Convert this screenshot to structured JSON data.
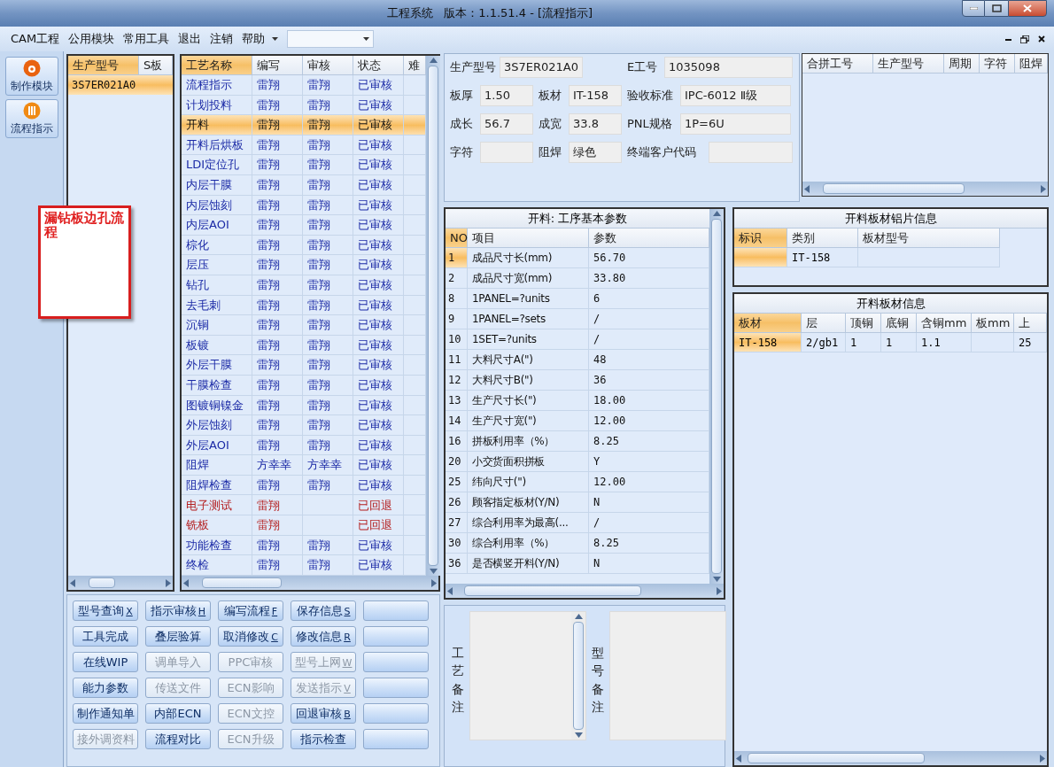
{
  "window": {
    "title": "工程系统   版本：1.1.51.4 - [流程指示]"
  },
  "menu": [
    "CAM工程",
    "公用模块",
    "常用工具",
    "退出",
    "注销",
    "帮助"
  ],
  "nav": [
    {
      "label": "制作模块",
      "kind": "flame"
    },
    {
      "label": "流程指示",
      "kind": "bars"
    }
  ],
  "note": {
    "text": "漏钻板边孔流程"
  },
  "products": {
    "columns": [
      "生产型号",
      "S板"
    ],
    "rows": [
      {
        "model": "3S7ER021A0",
        "selected": true
      }
    ]
  },
  "process": {
    "columns": [
      "工艺名称",
      "编写",
      "审核",
      "状态",
      "难"
    ],
    "rows": [
      {
        "name": "流程指示",
        "writer": "雷翔",
        "reviewer": "雷翔",
        "status": "已审核",
        "returned": false,
        "selected": false
      },
      {
        "name": "计划投料",
        "writer": "雷翔",
        "reviewer": "雷翔",
        "status": "已审核",
        "returned": false,
        "selected": false
      },
      {
        "name": "开料",
        "writer": "雷翔",
        "reviewer": "雷翔",
        "status": "已审核",
        "returned": false,
        "selected": true
      },
      {
        "name": "开料后烘板",
        "writer": "雷翔",
        "reviewer": "雷翔",
        "status": "已审核",
        "returned": false,
        "selected": false
      },
      {
        "name": "LDI定位孔",
        "writer": "雷翔",
        "reviewer": "雷翔",
        "status": "已审核",
        "returned": false,
        "selected": false
      },
      {
        "name": "内层干膜",
        "writer": "雷翔",
        "reviewer": "雷翔",
        "status": "已审核",
        "returned": false,
        "selected": false
      },
      {
        "name": "内层蚀刻",
        "writer": "雷翔",
        "reviewer": "雷翔",
        "status": "已审核",
        "returned": false,
        "selected": false
      },
      {
        "name": "内层AOI",
        "writer": "雷翔",
        "reviewer": "雷翔",
        "status": "已审核",
        "returned": false,
        "selected": false
      },
      {
        "name": "棕化",
        "writer": "雷翔",
        "reviewer": "雷翔",
        "status": "已审核",
        "returned": false,
        "selected": false
      },
      {
        "name": "层压",
        "writer": "雷翔",
        "reviewer": "雷翔",
        "status": "已审核",
        "returned": false,
        "selected": false
      },
      {
        "name": "钻孔",
        "writer": "雷翔",
        "reviewer": "雷翔",
        "status": "已审核",
        "returned": false,
        "selected": false
      },
      {
        "name": "去毛刺",
        "writer": "雷翔",
        "reviewer": "雷翔",
        "status": "已审核",
        "returned": false,
        "selected": false
      },
      {
        "name": "沉铜",
        "writer": "雷翔",
        "reviewer": "雷翔",
        "status": "已审核",
        "returned": false,
        "selected": false
      },
      {
        "name": "板镀",
        "writer": "雷翔",
        "reviewer": "雷翔",
        "status": "已审核",
        "returned": false,
        "selected": false
      },
      {
        "name": "外层干膜",
        "writer": "雷翔",
        "reviewer": "雷翔",
        "status": "已审核",
        "returned": false,
        "selected": false
      },
      {
        "name": "干膜检查",
        "writer": "雷翔",
        "reviewer": "雷翔",
        "status": "已审核",
        "returned": false,
        "selected": false
      },
      {
        "name": "图镀铜镍金",
        "writer": "雷翔",
        "reviewer": "雷翔",
        "status": "已审核",
        "returned": false,
        "selected": false
      },
      {
        "name": "外层蚀刻",
        "writer": "雷翔",
        "reviewer": "雷翔",
        "status": "已审核",
        "returned": false,
        "selected": false
      },
      {
        "name": "外层AOI",
        "writer": "雷翔",
        "reviewer": "雷翔",
        "status": "已审核",
        "returned": false,
        "selected": false
      },
      {
        "name": "阻焊",
        "writer": "方幸幸",
        "reviewer": "方幸幸",
        "status": "已审核",
        "returned": false,
        "selected": false
      },
      {
        "name": "阻焊检查",
        "writer": "雷翔",
        "reviewer": "雷翔",
        "status": "已审核",
        "returned": false,
        "selected": false
      },
      {
        "name": "电子测试",
        "writer": "雷翔",
        "status": "已回退",
        "returned": true,
        "selected": false
      },
      {
        "name": "铣板",
        "writer": "雷翔",
        "status": "已回退",
        "returned": true,
        "selected": false
      },
      {
        "name": "功能检查",
        "writer": "雷翔",
        "reviewer": "雷翔",
        "status": "已审核",
        "returned": false,
        "selected": false
      },
      {
        "name": "终检",
        "writer": "雷翔",
        "reviewer": "雷翔",
        "status": "已审核",
        "returned": false,
        "selected": false
      }
    ]
  },
  "actions": [
    {
      "label": "型号查询",
      "shortcut": "X",
      "disabled": false
    },
    {
      "label": "指示审核",
      "shortcut": "H",
      "disabled": false
    },
    {
      "label": "编写流程",
      "shortcut": "F",
      "disabled": false
    },
    {
      "label": "保存信息",
      "shortcut": "S",
      "disabled": false
    },
    {
      "disabled": false
    },
    {
      "label": "工具完成",
      "disabled": false
    },
    {
      "label": "叠层验算",
      "disabled": false
    },
    {
      "label": "取消修改",
      "shortcut": "C",
      "disabled": false
    },
    {
      "label": "修改信息",
      "shortcut": "R",
      "disabled": false
    },
    {
      "disabled": false
    },
    {
      "label": "在线WIP",
      "disabled": false
    },
    {
      "label": "调单导入",
      "disabled": true
    },
    {
      "label": "PPC审核",
      "disabled": true
    },
    {
      "label": "型号上网",
      "shortcut": "W",
      "disabled": true
    },
    {
      "disabled": false
    },
    {
      "label": "能力参数",
      "disabled": false
    },
    {
      "label": "传送文件",
      "disabled": true
    },
    {
      "label": "ECN影响",
      "disabled": true
    },
    {
      "label": "发送指示",
      "shortcut": "V",
      "disabled": true
    },
    {
      "disabled": false
    },
    {
      "label": "制作通知单",
      "disabled": false
    },
    {
      "label": "内部ECN",
      "disabled": false
    },
    {
      "label": "ECN文控",
      "disabled": true
    },
    {
      "label": "回退审核",
      "shortcut": "B",
      "disabled": false
    },
    {
      "disabled": false
    },
    {
      "label": "接外调资料",
      "disabled": true
    },
    {
      "label": "流程对比",
      "disabled": false
    },
    {
      "label": "ECN升级",
      "disabled": true
    },
    {
      "label": "指示检查",
      "disabled": false
    },
    {
      "disabled": false
    }
  ],
  "info": {
    "rows": [
      [
        {
          "label": "生产型号",
          "value": "3S7ER021A0"
        },
        null,
        {
          "label": "E工号",
          "value": "1035098"
        }
      ],
      [
        {
          "label": "板厚",
          "value": "1.50"
        },
        {
          "label": "板材",
          "value": "IT-158"
        },
        {
          "label": "验收标准",
          "value": "IPC-6012 Ⅱ级"
        }
      ],
      [
        {
          "label": "成长",
          "value": "56.7"
        },
        {
          "label": "成宽",
          "value": "33.8"
        },
        {
          "label": "PNL规格",
          "value": "1P=6U"
        }
      ],
      [
        {
          "label": "字符"
        },
        {
          "label": "阻焊",
          "value": "绿色"
        },
        {
          "label": "终端客户代码"
        }
      ]
    ]
  },
  "merge_grid": {
    "columns": [
      "合拼工号",
      "生产型号",
      "周期",
      "字符",
      "阻焊"
    ]
  },
  "params": {
    "title": "开料: 工序基本参数",
    "columns": [
      "NO",
      "项目",
      "参数"
    ],
    "rows": [
      {
        "no": "1",
        "item": "成品尺寸长(mm)",
        "value": "56.70",
        "selected": true
      },
      {
        "no": "2",
        "item": "成品尺寸宽(mm)",
        "value": "33.80",
        "selected": false
      },
      {
        "no": "8",
        "item": "1PANEL=?units",
        "value": "6",
        "selected": false
      },
      {
        "no": "9",
        "item": "1PANEL=?sets",
        "value": "/",
        "selected": false
      },
      {
        "no": "10",
        "item": "1SET=?units",
        "value": "/",
        "selected": false
      },
      {
        "no": "11",
        "item": "大料尺寸A(\")",
        "value": "48",
        "selected": false
      },
      {
        "no": "12",
        "item": "大料尺寸B(\")",
        "value": "36",
        "selected": false
      },
      {
        "no": "13",
        "item": "生产尺寸长(\")",
        "value": "18.00",
        "selected": false
      },
      {
        "no": "14",
        "item": "生产尺寸宽(\")",
        "value": "12.00",
        "selected": false
      },
      {
        "no": "16",
        "item": "拼板利用率（%）",
        "value": "8.25",
        "selected": false
      },
      {
        "no": "20",
        "item": "小交货面积拼板",
        "value": "Y",
        "selected": false
      },
      {
        "no": "25",
        "item": "纬向尺寸(\")",
        "value": "12.00",
        "selected": false
      },
      {
        "no": "26",
        "item": "顾客指定板材(Y/N)",
        "value": "N",
        "selected": false
      },
      {
        "no": "27",
        "item": "综合利用率为最高(...",
        "value": "/",
        "selected": false
      },
      {
        "no": "30",
        "item": "综合利用率（%）",
        "value": "8.25",
        "selected": false
      },
      {
        "no": "36",
        "item": "是否横竖开料(Y/N)",
        "value": "N",
        "selected": false
      }
    ]
  },
  "foil": {
    "title": "开料板材铝片信息",
    "columns": [
      "标识",
      "类别",
      "板材型号"
    ],
    "rows": [
      {
        "cells": [
          null,
          "IT-158",
          null
        ]
      }
    ]
  },
  "sheet": {
    "title": "开料板材信息",
    "columns": [
      "板材",
      "层",
      "顶铜",
      "底铜",
      "含铜mm",
      "板mm",
      "上"
    ],
    "rows": [
      {
        "cells": [
          "IT-158",
          "2/gb1",
          "1",
          "1",
          "1.1",
          null,
          "25"
        ]
      }
    ]
  },
  "remarks": [
    {
      "label": "工艺备注"
    },
    {
      "label": "型号备注"
    }
  ]
}
